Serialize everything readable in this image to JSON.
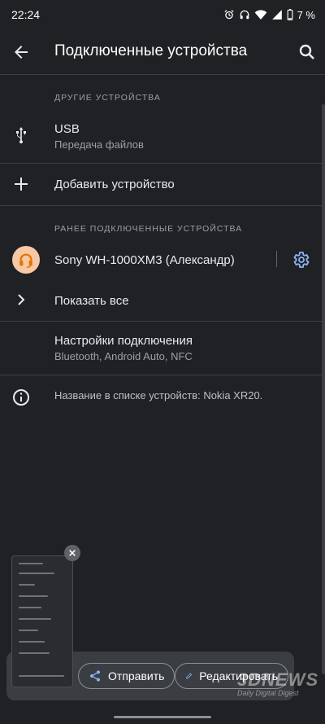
{
  "status_bar": {
    "time": "22:24",
    "battery_percent": "7 %",
    "icons": [
      "alarm-icon",
      "headphones-icon",
      "wifi-icon",
      "signal-icon",
      "battery-icon"
    ]
  },
  "app_bar": {
    "title": "Подключенные устройства",
    "back_icon": "arrow-back-icon",
    "search_icon": "search-icon"
  },
  "sections": {
    "other": {
      "header": "ДРУГИЕ УСТРОЙСТВА",
      "usb": {
        "title": "USB",
        "subtitle": "Передача файлов",
        "icon": "usb-icon"
      }
    },
    "add_device": {
      "label": "Добавить устройство",
      "icon": "plus-icon"
    },
    "previous": {
      "header": "РАНЕЕ ПОДКЛЮЧЕННЫЕ УСТРОЙСТВА",
      "device": {
        "name": "Sony WH-1000XM3 (Александр)",
        "icon": "headset-icon",
        "settings_icon": "gear-icon"
      },
      "show_all": "Показать все"
    },
    "connection_settings": {
      "title": "Настройки подключения",
      "subtitle": "Bluetooth, Android Auto, NFC"
    },
    "device_name_info": "Название в списке устройств: Nokia XR20."
  },
  "screenshot_overlay": {
    "share_label": "Отправить",
    "edit_label": "Редактировать"
  },
  "watermark": {
    "brand": "3DNEWS",
    "tagline": "Daily Digital Digest"
  },
  "colors": {
    "accent": "#8ab4f8",
    "background": "#202124",
    "avatar_bg": "#f6c8a4",
    "avatar_fg": "#e37400"
  }
}
